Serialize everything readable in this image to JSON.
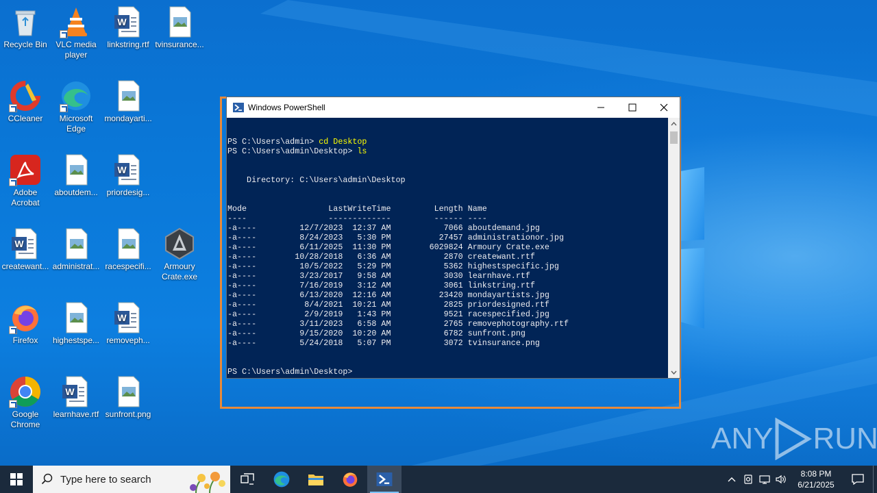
{
  "desktop": {
    "icons": [
      {
        "label": "Recycle Bin",
        "icon": "recycle-bin-icon"
      },
      {
        "label": "VLC media player",
        "icon": "vlc-icon"
      },
      {
        "label": "linkstring.rtf",
        "icon": "word-doc-icon"
      },
      {
        "label": "tvinsurance...",
        "icon": "image-file-icon"
      },
      {
        "label": "CCleaner",
        "icon": "ccleaner-icon"
      },
      {
        "label": "Microsoft Edge",
        "icon": "edge-icon"
      },
      {
        "label": "mondayarti...",
        "icon": "image-file-icon"
      },
      {
        "label": "Adobe Acrobat",
        "icon": "acrobat-icon"
      },
      {
        "label": "aboutdem...",
        "icon": "image-file-icon"
      },
      {
        "label": "priordesig...",
        "icon": "word-doc-icon"
      },
      {
        "label": "createwant...",
        "icon": "word-doc-icon"
      },
      {
        "label": "administrat...",
        "icon": "image-file-icon"
      },
      {
        "label": "racespecifi...",
        "icon": "image-file-icon"
      },
      {
        "label": "Armoury Crate.exe",
        "icon": "armoury-crate-icon"
      },
      {
        "label": "Firefox",
        "icon": "firefox-icon"
      },
      {
        "label": "highestspe...",
        "icon": "image-file-icon"
      },
      {
        "label": "removeph...",
        "icon": "word-doc-icon"
      },
      {
        "label": "Google Chrome",
        "icon": "chrome-icon"
      },
      {
        "label": "learnhave.rtf",
        "icon": "word-doc-icon"
      },
      {
        "label": "sunfront.png",
        "icon": "image-file-icon"
      }
    ]
  },
  "powershell": {
    "title": "Windows PowerShell",
    "lines": [
      {
        "prompt": "PS C:\\Users\\admin> ",
        "cmd": "cd Desktop"
      },
      {
        "prompt": "PS C:\\Users\\admin\\Desktop> ",
        "cmd": "ls"
      },
      {
        "prompt": "",
        "cmd": ""
      },
      {
        "prompt": "",
        "cmd": ""
      },
      {
        "prompt": "    Directory: C:\\Users\\admin\\Desktop",
        "cmd": ""
      },
      {
        "prompt": "",
        "cmd": ""
      },
      {
        "prompt": "",
        "cmd": ""
      },
      {
        "prompt": "Mode                 LastWriteTime         Length Name",
        "cmd": ""
      },
      {
        "prompt": "----                 -------------         ------ ----",
        "cmd": ""
      },
      {
        "prompt": "-a----         12/7/2023  12:37 AM           7066 aboutdemand.jpg",
        "cmd": ""
      },
      {
        "prompt": "-a----         8/24/2023   5:30 PM          27457 administrationor.jpg",
        "cmd": ""
      },
      {
        "prompt": "-a----         6/11/2025  11:30 PM        6029824 Armoury Crate.exe",
        "cmd": ""
      },
      {
        "prompt": "-a----        10/28/2018   6:36 AM           2870 createwant.rtf",
        "cmd": ""
      },
      {
        "prompt": "-a----         10/5/2022   5:29 PM           5362 highestspecific.jpg",
        "cmd": ""
      },
      {
        "prompt": "-a----         3/23/2017   9:58 AM           3030 learnhave.rtf",
        "cmd": ""
      },
      {
        "prompt": "-a----         7/16/2019   3:12 AM           3061 linkstring.rtf",
        "cmd": ""
      },
      {
        "prompt": "-a----         6/13/2020  12:16 AM          23420 mondayartists.jpg",
        "cmd": ""
      },
      {
        "prompt": "-a----          8/4/2021  10:21 AM           2825 priordesigned.rtf",
        "cmd": ""
      },
      {
        "prompt": "-a----          2/9/2019   1:43 PM           9521 racespecified.jpg",
        "cmd": ""
      },
      {
        "prompt": "-a----         3/11/2023   6:58 AM           2765 removephotography.rtf",
        "cmd": ""
      },
      {
        "prompt": "-a----         9/15/2020  10:20 AM           6782 sunfront.png",
        "cmd": ""
      },
      {
        "prompt": "-a----         5/24/2018   5:07 PM           3072 tvinsurance.png",
        "cmd": ""
      },
      {
        "prompt": "",
        "cmd": ""
      },
      {
        "prompt": "",
        "cmd": ""
      },
      {
        "prompt": "PS C:\\Users\\admin\\Desktop>",
        "cmd": ""
      }
    ],
    "colors": {
      "background": "#012456",
      "text": "#eeedf0",
      "command": "#ffff00"
    }
  },
  "watermark": {
    "text_left": "ANY",
    "text_right": "RUN"
  },
  "taskbar": {
    "search_placeholder": "Type here to search",
    "apps": [
      "task-view-icon",
      "edge-icon",
      "file-explorer-icon",
      "firefox-icon",
      "powershell-icon"
    ],
    "active_app": "powershell-icon",
    "clock_time": "8:08 PM",
    "clock_date": "6/21/2025"
  },
  "highlight_color": "#e88a3a"
}
